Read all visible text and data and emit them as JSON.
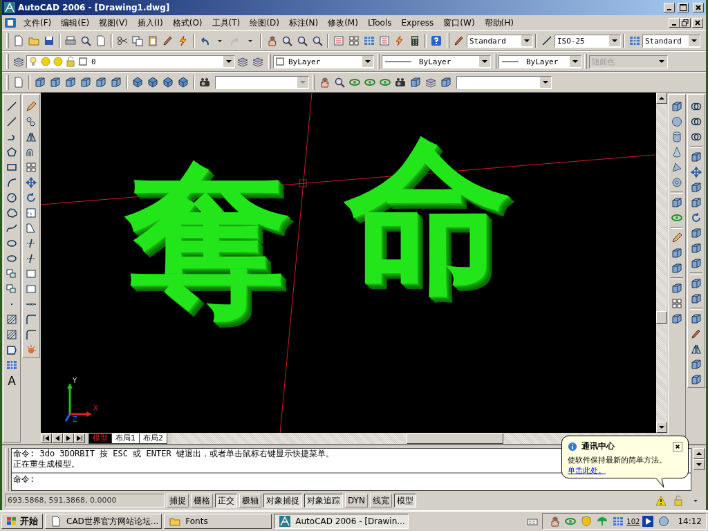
{
  "window": {
    "title": "AutoCAD 2006 - [Drawing1.dwg]"
  },
  "menu": {
    "items": [
      {
        "label": "文件(F)"
      },
      {
        "label": "编辑(E)"
      },
      {
        "label": "视图(V)"
      },
      {
        "label": "插入(I)"
      },
      {
        "label": "格式(O)"
      },
      {
        "label": "工具(T)"
      },
      {
        "label": "绘图(D)"
      },
      {
        "label": "标注(N)"
      },
      {
        "label": "修改(M)"
      },
      {
        "label": "LTools"
      },
      {
        "label": "Express"
      },
      {
        "label": "窗口(W)"
      },
      {
        "label": "帮助(H)"
      }
    ]
  },
  "styles_toolbar": {
    "text_style": "Standard",
    "dim_style": "ISO-25",
    "table_style": "Standard"
  },
  "layers_toolbar": {
    "layer": "0"
  },
  "properties_toolbar": {
    "color_control": "ByLayer",
    "linetype": "ByLayer",
    "lineweight": "ByLayer",
    "plot_style": {
      "value": "随颜色",
      "disabled": true
    }
  },
  "draw_toolbar": {
    "text_glyph": "A"
  },
  "canvas": {
    "texts": [
      "奪",
      "命"
    ],
    "ucs": {
      "x": "X",
      "y": "Y",
      "z": "Z"
    }
  },
  "layout_tabs": [
    {
      "label": "模型",
      "selected": true
    },
    {
      "label": "布局1",
      "selected": false
    },
    {
      "label": "布局2",
      "selected": false
    }
  ],
  "command": {
    "history": [
      "命令: 3do 3DORBIT 按 ESC 或 ENTER 键退出，或者单击鼠标右键显示快捷菜单。",
      "正在重生成模型。"
    ],
    "prompt": "命令:"
  },
  "status_bar": {
    "coordinates": "693.5868, 591.3868, 0.0000",
    "toggles": [
      {
        "label": "捕捉",
        "on": false
      },
      {
        "label": "栅格",
        "on": false
      },
      {
        "label": "正交",
        "on": true
      },
      {
        "label": "极轴",
        "on": false
      },
      {
        "label": "对象捕捉",
        "on": true
      },
      {
        "label": "对象追踪",
        "on": true
      },
      {
        "label": "DYN",
        "on": false
      },
      {
        "label": "线宽",
        "on": false
      },
      {
        "label": "模型",
        "on": true
      }
    ]
  },
  "balloon": {
    "title": "通讯中心",
    "text": "使软件保持最新的简单方法。",
    "link": "单击此处。"
  },
  "taskbar": {
    "start": "开始",
    "tasks": [
      {
        "label": "CAD世界官方网站论坛...",
        "selected": false
      },
      {
        "label": "Fonts",
        "selected": false
      },
      {
        "label": "AutoCAD 2006 - [Drawin...",
        "selected": true
      }
    ],
    "tray_number": "102",
    "clock": "14:12"
  }
}
